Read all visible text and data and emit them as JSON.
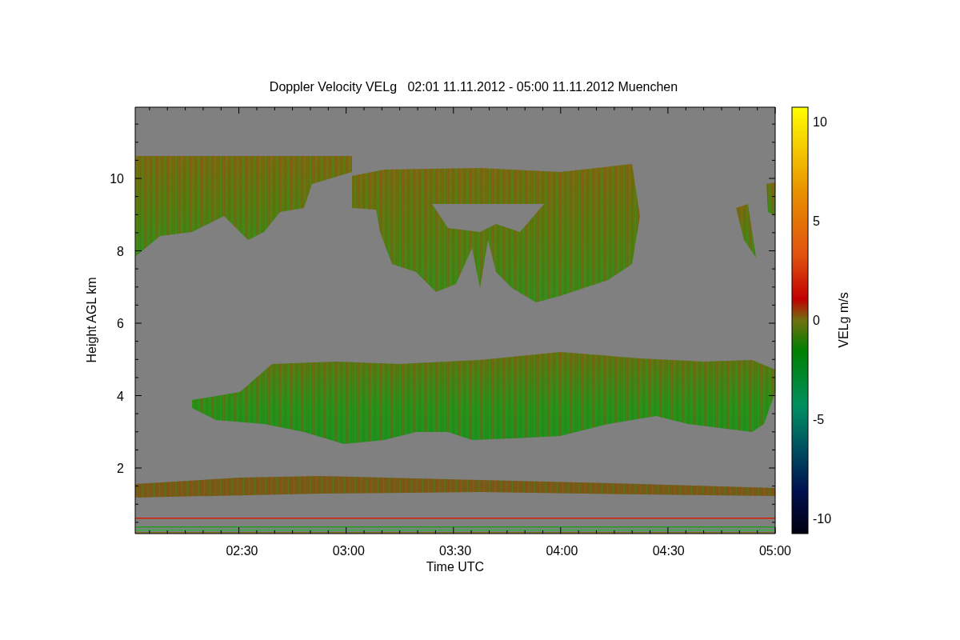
{
  "title": "Doppler Velocity VELg   02:01 11.11.2012 - 05:00 11.11.2012 Muenchen",
  "plot": {
    "xlabel": "Time UTC",
    "ylabel": "Height AGL km",
    "xtick_labels": [
      "02:30",
      "03:00",
      "03:30",
      "04:00",
      "04:30",
      "05:00"
    ],
    "ytick_labels": [
      "10",
      "8",
      "6",
      "4",
      "2"
    ]
  },
  "colorbar": {
    "label": "VELg m/s",
    "tick_labels": [
      "10",
      "5",
      "0",
      "-5",
      "-10"
    ]
  }
}
